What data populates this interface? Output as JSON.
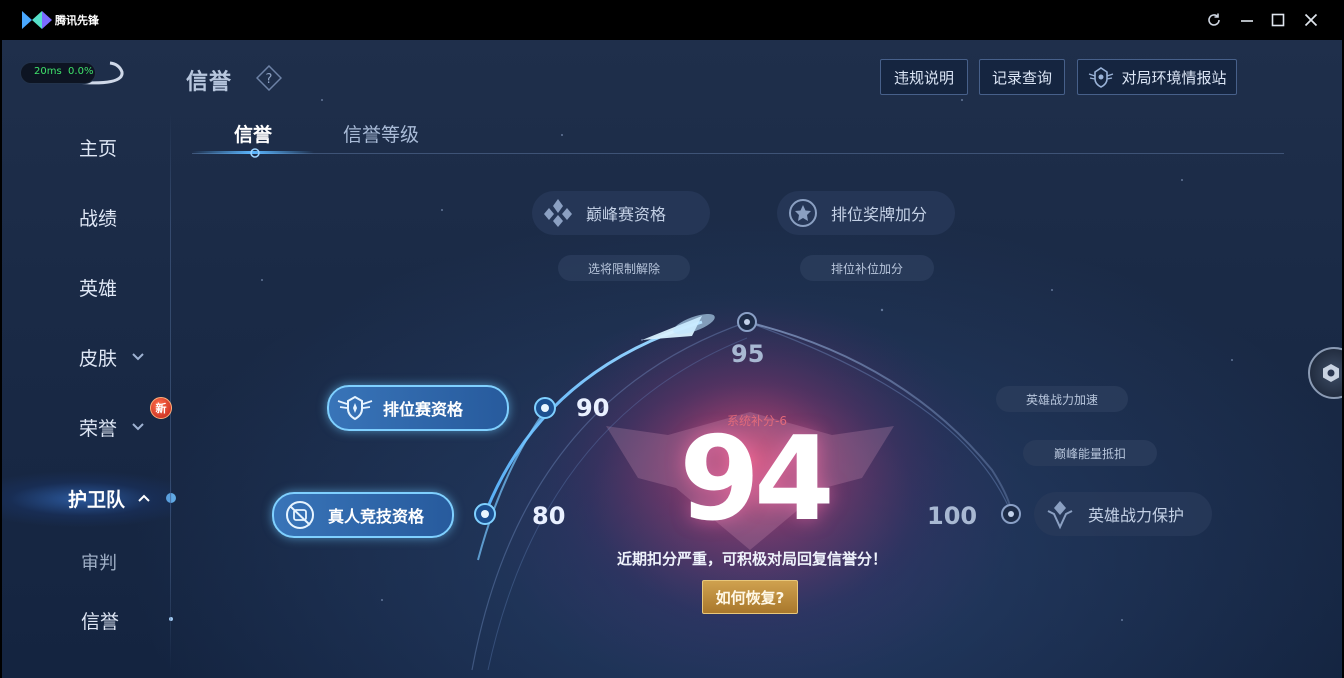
{
  "window": {
    "app_name": "腾讯先锋",
    "controls": [
      "refresh-icon",
      "minimize-icon",
      "maximize-icon",
      "close-icon"
    ]
  },
  "status": {
    "ping": "20ms",
    "loss": "0.0%"
  },
  "header": {
    "title": "信誉",
    "help_icon": "question-icon",
    "buttons": [
      {
        "label": "违规说明"
      },
      {
        "label": "记录查询"
      },
      {
        "label": "对局环境情报站",
        "icon": "shield-wing-icon"
      }
    ]
  },
  "sidebar": {
    "items": [
      {
        "label": "主页"
      },
      {
        "label": "战绩"
      },
      {
        "label": "英雄"
      },
      {
        "label": "皮肤",
        "chevron": "chevron-down-icon"
      },
      {
        "label": "荣誉",
        "chevron": "chevron-down-icon",
        "badge": "新"
      },
      {
        "label": "护卫队",
        "chevron": "chevron-up-icon",
        "active": true
      },
      {
        "label": "审判"
      },
      {
        "label": "信誉"
      }
    ]
  },
  "tabs": [
    {
      "label": "信誉",
      "active": true
    },
    {
      "label": "信誉等级",
      "active": false
    }
  ],
  "credit": {
    "score": "94",
    "system_note": "系统补分-6",
    "message": "近期扣分严重，可积极对局回复信誉分！",
    "recover_button": "如何恢复?",
    "thresholds": {
      "t80": "80",
      "t90": "90",
      "t95": "95",
      "t100": "100"
    },
    "privileges": {
      "peak": {
        "label": "巅峰赛资格",
        "sub": "选将限制解除"
      },
      "rank_medal": {
        "label": "排位奖牌加分",
        "sub": "排位补位加分"
      },
      "ranked": {
        "label": "排位赛资格"
      },
      "real_competition": {
        "label": "真人竞技资格"
      },
      "hero_power": {
        "label": "英雄战力保护",
        "subs": [
          "英雄战力加速",
          "巅峰能量抵扣"
        ]
      }
    }
  },
  "colors": {
    "accent_blue": "#5bb6ff",
    "gold_button": "#cfa14f",
    "warning_red": "#e26a7a",
    "ping_green": "#3fe36b"
  }
}
